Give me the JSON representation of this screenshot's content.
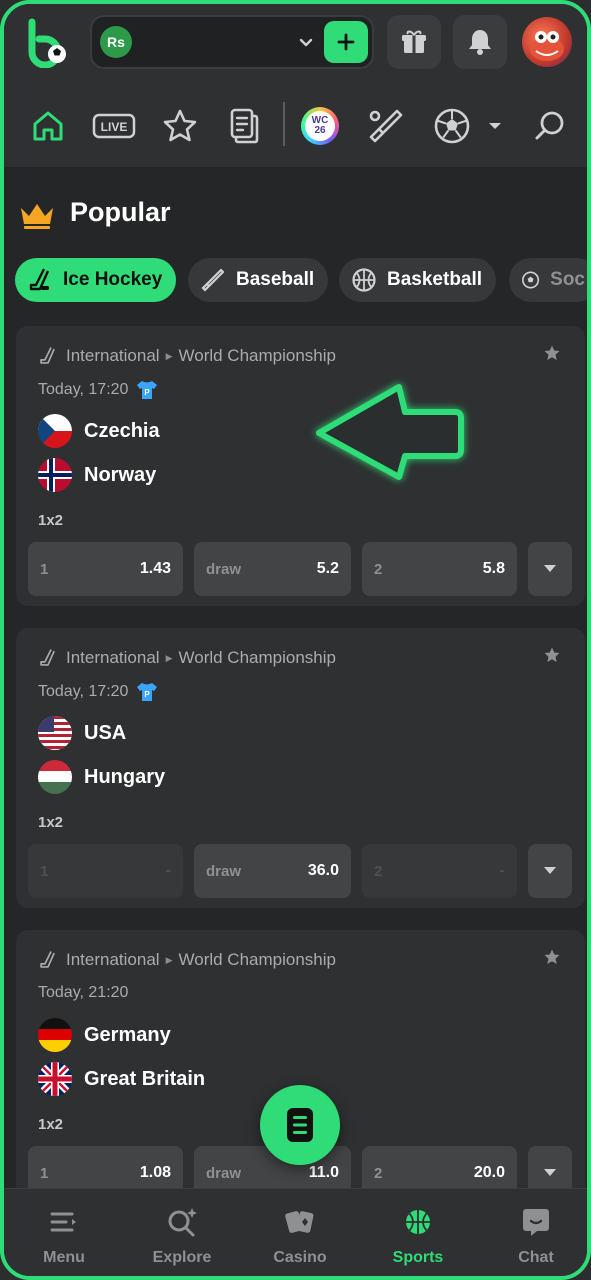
{
  "header": {
    "currency_badge": "Rs",
    "colors": {
      "accent": "#2fdc78",
      "background": "#252627"
    }
  },
  "nav_icons": [
    "home-icon",
    "live-icon",
    "star-icon",
    "betslip-list-icon",
    "world-cup-icon",
    "cricket-icon",
    "soccer-icon",
    "chevron-down-icon",
    "search-icon"
  ],
  "nav": {
    "live_label": "LIVE",
    "wc_badge": "WC 26"
  },
  "section": {
    "title": "Popular"
  },
  "sport_chips": [
    {
      "label": "Ice Hockey",
      "icon": "hockey-icon",
      "active": true
    },
    {
      "label": "Baseball",
      "icon": "baseball-bat-icon",
      "active": false
    },
    {
      "label": "Basketball",
      "icon": "basketball-icon",
      "active": false
    },
    {
      "label": "Soc",
      "icon": "soccer-icon",
      "active": false
    }
  ],
  "matches": [
    {
      "category": "International",
      "league": "World Championship",
      "time": "Today, 17:20",
      "has_shirt_badge": true,
      "home": "Czechia",
      "away": "Norway",
      "market": "1x2",
      "odds": [
        {
          "label": "1",
          "value": "1.43",
          "enabled": true
        },
        {
          "label": "draw",
          "value": "5.2",
          "enabled": true
        },
        {
          "label": "2",
          "value": "5.8",
          "enabled": true
        }
      ]
    },
    {
      "category": "International",
      "league": "World Championship",
      "time": "Today, 17:20",
      "has_shirt_badge": true,
      "home": "USA",
      "away": "Hungary",
      "market": "1x2",
      "odds": [
        {
          "label": "1",
          "value": "-",
          "enabled": false
        },
        {
          "label": "draw",
          "value": "36.0",
          "enabled": true
        },
        {
          "label": "2",
          "value": "-",
          "enabled": false
        }
      ]
    },
    {
      "category": "International",
      "league": "World Championship",
      "time": "Today, 21:20",
      "has_shirt_badge": false,
      "home": "Germany",
      "away": "Great Britain",
      "market": "1x2",
      "odds": [
        {
          "label": "1",
          "value": "1.08",
          "enabled": true
        },
        {
          "label": "draw",
          "value": "11.0",
          "enabled": true
        },
        {
          "label": "2",
          "value": "20.0",
          "enabled": true
        }
      ]
    }
  ],
  "bottom_nav": [
    {
      "label": "Menu",
      "icon": "menu-icon",
      "active": false
    },
    {
      "label": "Explore",
      "icon": "explore-icon",
      "active": false
    },
    {
      "label": "Casino",
      "icon": "cards-icon",
      "active": false
    },
    {
      "label": "Sports",
      "icon": "basketball-icon",
      "active": true
    },
    {
      "label": "Chat",
      "icon": "chat-icon",
      "active": false
    }
  ]
}
